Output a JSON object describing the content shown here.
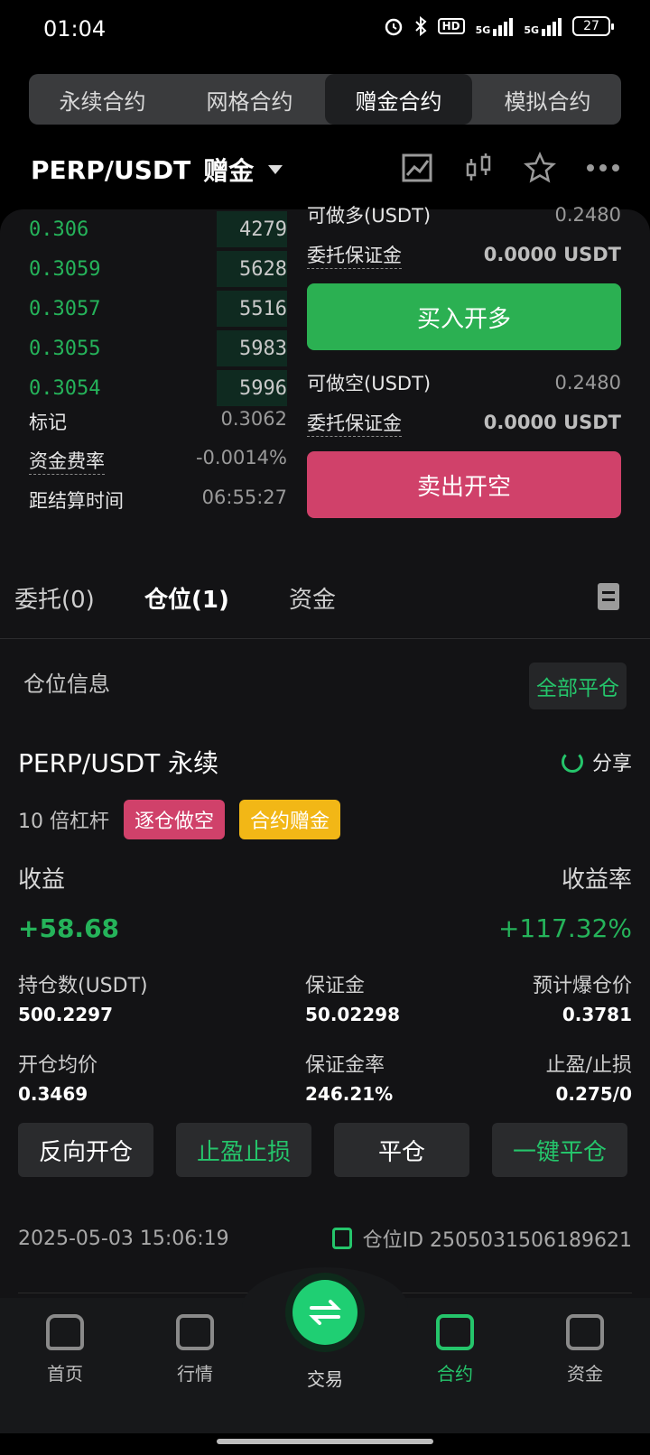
{
  "status": {
    "time": "01:04",
    "hd": "HD",
    "net1": "5G",
    "net2": "5G",
    "battery": "27"
  },
  "top_tabs": [
    {
      "label": "永续合约"
    },
    {
      "label": "网格合约"
    },
    {
      "label": "赠金合约",
      "active": true
    },
    {
      "label": "模拟合约"
    }
  ],
  "header": {
    "pair": "PERP/USDT",
    "tag": "赠金"
  },
  "orderbook": [
    {
      "price": "0.306",
      "qty": "4279",
      "depth": 0.27
    },
    {
      "price": "0.3059",
      "qty": "5628",
      "depth": 0.27
    },
    {
      "price": "0.3057",
      "qty": "5516",
      "depth": 0.27
    },
    {
      "price": "0.3055",
      "qty": "5983",
      "depth": 0.27
    },
    {
      "price": "0.3054",
      "qty": "5996",
      "depth": 0.27
    }
  ],
  "market": {
    "mark_label": "标记",
    "mark_value": "0.3062",
    "funding_label": "资金费率",
    "funding_value": "-0.0014%",
    "settle_label": "距结算时间",
    "settle_value": "06:55:27"
  },
  "long": {
    "avail_label": "可做多(USDT)",
    "avail_value": "0.2480",
    "margin_label": "委托保证金",
    "margin_value": "0.0000 USDT",
    "button": "买入开多"
  },
  "short": {
    "avail_label": "可做空(USDT)",
    "avail_value": "0.2480",
    "margin_label": "委托保证金",
    "margin_value": "0.0000 USDT",
    "button": "卖出开空"
  },
  "pos_tabs": {
    "orders": "委托(0)",
    "positions": "仓位(1)",
    "funds": "资金"
  },
  "position": {
    "section_title": "仓位信息",
    "close_all": "全部平仓",
    "name": "PERP/USDT 永续",
    "share": "分享",
    "leverage": "10 倍杠杆",
    "badge_side": "逐仓做空",
    "badge_bonus": "合约赠金",
    "pnl_label": "收益",
    "pnl_value": "+58.68",
    "roe_label": "收益率",
    "roe_value": "+117.32%",
    "size_label": "持仓数(USDT)",
    "size_value": "500.2297",
    "margin_label": "保证金",
    "margin_value": "50.02298",
    "liq_label": "预计爆仓价",
    "liq_value": "0.3781",
    "entry_label": "开仓均价",
    "entry_value": "0.3469",
    "ratio_label": "保证金率",
    "ratio_value": "246.21%",
    "tpsl_label": "止盈/止损",
    "tpsl_value": "0.275/0",
    "btn_reverse": "反向开仓",
    "btn_tpsl": "止盈止损",
    "btn_close": "平仓",
    "btn_quick_close": "一键平仓",
    "timestamp": "2025-05-03 15:06:19",
    "position_id": "仓位ID 2505031506189621"
  },
  "nav": {
    "home": "首页",
    "market": "行情",
    "trade": "交易",
    "futures": "合约",
    "assets": "资金"
  },
  "colors": {
    "green": "#2bb052",
    "red": "#d0416a",
    "yellow": "#f2b716",
    "accent": "#25c56b"
  }
}
